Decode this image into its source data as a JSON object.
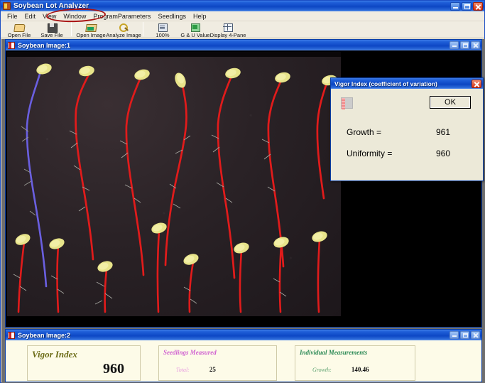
{
  "window": {
    "title": "Soybean Lot Analyzer",
    "icon": "app-icon",
    "buttons": {
      "minimize": "Minimize",
      "maximize": "Maximize",
      "close": "Close"
    }
  },
  "menubar": {
    "items": [
      {
        "label": "File"
      },
      {
        "label": "Edit"
      },
      {
        "label": "View"
      },
      {
        "label": "Window"
      },
      {
        "label": "ProgramParameters"
      },
      {
        "label": "Seedlings"
      },
      {
        "label": "Help"
      }
    ]
  },
  "toolbar": {
    "buttons": [
      {
        "label": "Open File",
        "icon": "open-file-icon"
      },
      {
        "label": "Save File",
        "icon": "save-file-icon"
      },
      {
        "label": "Open Image",
        "icon": "open-image-icon"
      },
      {
        "label": "Analyze Image",
        "icon": "analyze-image-icon"
      },
      {
        "label": "100%",
        "icon": "zoom-100-icon"
      },
      {
        "label": "G & U Value",
        "icon": "gu-value-icon"
      },
      {
        "label": "Display 4-Pane",
        "icon": "display-4pane-icon"
      }
    ]
  },
  "image_window": {
    "title": "Soybean Image:1",
    "buttons": {
      "minimize": "Minimize",
      "maximize": "Maximize",
      "close": "Close"
    }
  },
  "results_window": {
    "title": "Soybean Image:2",
    "buttons": {
      "minimize": "Minimize",
      "maximize": "Maximize",
      "close": "Close"
    },
    "cards": [
      {
        "heading": "Vigor Index",
        "value": "960"
      },
      {
        "heading": "Seedlings Measured",
        "metric_label": "Total:",
        "metric_value": "25"
      },
      {
        "heading": "Individual Measurements",
        "metric_label": "Growth:",
        "metric_value": "140.46"
      }
    ]
  },
  "dialog": {
    "title": "Vigor Index (coefficient of variation)",
    "close_label": "Close",
    "ok_label": "OK",
    "rows": [
      {
        "label": "Growth =",
        "value": "961"
      },
      {
        "label": "Uniformity =",
        "value": "960"
      }
    ]
  },
  "annotations": {
    "accent_color": "#aa1414",
    "menu_highlight": "ProgramParameters",
    "growth_highlight": "961",
    "uniformity_highlight": "960"
  }
}
